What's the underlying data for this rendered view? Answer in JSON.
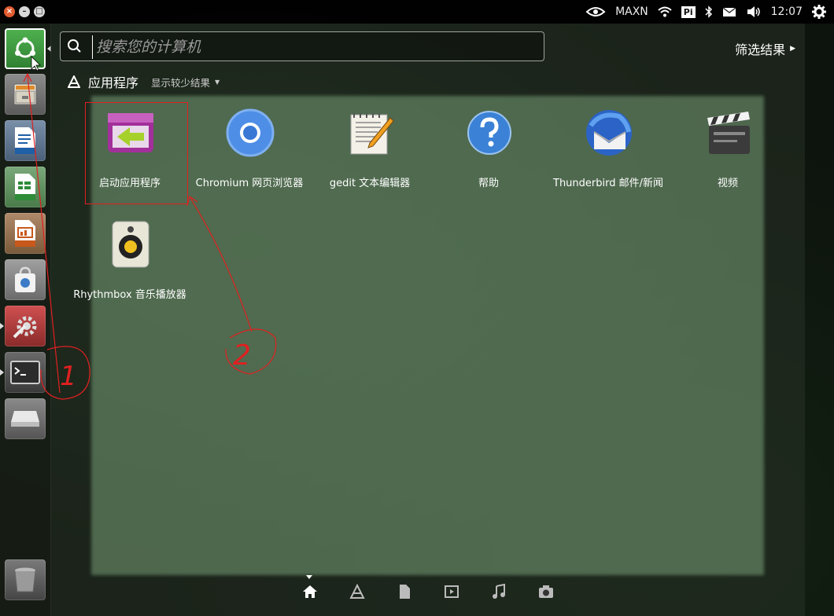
{
  "top_panel": {
    "window_controls": [
      {
        "name": "close",
        "glyph": "×"
      },
      {
        "name": "minimize",
        "glyph": "–"
      },
      {
        "name": "maximize",
        "glyph": "□"
      }
    ],
    "indicators": {
      "nvidia_mode": "MAXN",
      "pi_label": "Pi",
      "clock": "12:07"
    }
  },
  "launcher": {
    "items": [
      {
        "name": "dash-home",
        "icon": "ubuntu-logo-icon"
      },
      {
        "name": "files",
        "icon": "file-cabinet-icon"
      },
      {
        "name": "writer",
        "icon": "document-icon"
      },
      {
        "name": "calc",
        "icon": "spreadsheet-icon"
      },
      {
        "name": "impress",
        "icon": "presentation-icon"
      },
      {
        "name": "software",
        "icon": "shopping-bag-icon"
      },
      {
        "name": "settings",
        "icon": "wrench-gear-icon"
      },
      {
        "name": "terminal",
        "icon": "terminal-icon"
      },
      {
        "name": "drive",
        "icon": "drive-icon"
      },
      {
        "name": "trash",
        "icon": "trash-icon"
      }
    ]
  },
  "dash": {
    "search": {
      "value": "",
      "placeholder": "搜索您的计算机"
    },
    "filter_label": "筛选结果",
    "category": {
      "title": "应用程序",
      "toggle": "显示较少结果"
    },
    "apps": [
      {
        "label": "启动应用程序",
        "icon": "startup-apps-icon"
      },
      {
        "label": "Chromium 网页浏览器",
        "icon": "chromium-icon"
      },
      {
        "label": "gedit 文本编辑器",
        "icon": "text-editor-icon"
      },
      {
        "label": "帮助",
        "icon": "help-icon"
      },
      {
        "label": "Thunderbird 邮件/新闻",
        "icon": "thunderbird-icon"
      },
      {
        "label": "视频",
        "icon": "video-clapper-icon"
      },
      {
        "label": "Rhythmbox 音乐播放器",
        "icon": "speaker-icon"
      }
    ],
    "lenses": [
      "home-lens-icon",
      "apps-lens-icon",
      "files-lens-icon",
      "video-lens-icon",
      "music-lens-icon",
      "photo-lens-icon"
    ]
  },
  "annotations": {
    "label_1": "1",
    "label_2": "2",
    "color": "#e02020"
  },
  "colors": {
    "accent_green": "#3a9a40",
    "annotation_red": "#e02020"
  }
}
